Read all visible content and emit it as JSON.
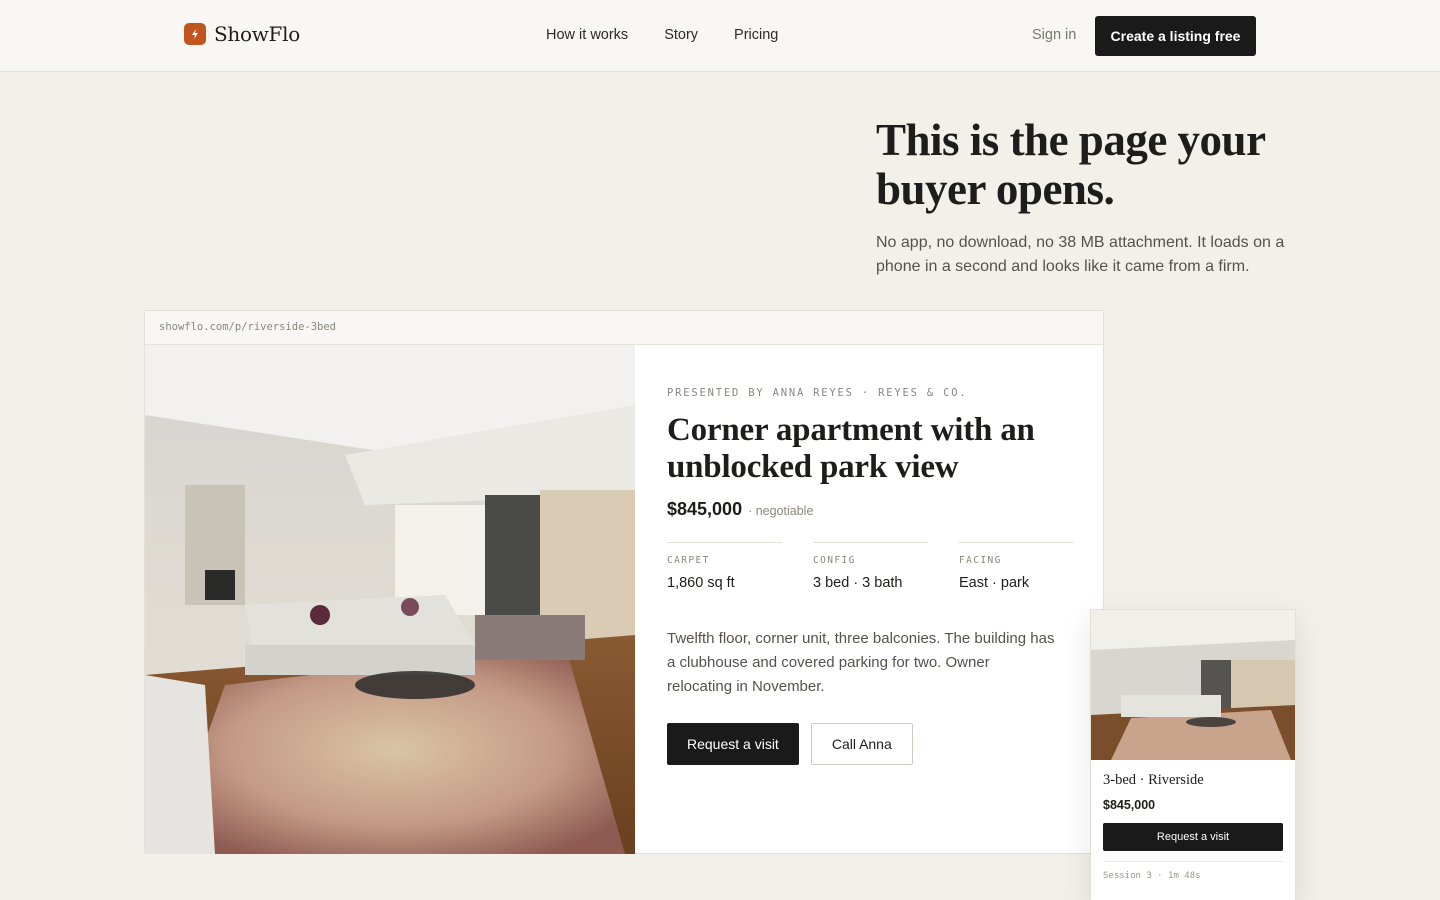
{
  "nav": {
    "brand": "ShowFlo",
    "links": [
      "How it works",
      "Story",
      "Pricing"
    ],
    "sign_in": "Sign in",
    "cta": "Create a listing free"
  },
  "hero": {
    "title": "This is the page your buyer opens.",
    "subtitle": "No app, no download, no 38 MB attachment. It loads on a phone in a second and looks like it came from a firm."
  },
  "listing": {
    "url": "showflo.com/p/riverside-3bed",
    "presented_by": "PRESENTED BY ANNA REYES · REYES & CO.",
    "title": "Corner apartment with an unblocked park view",
    "price": "$845,000",
    "price_note": "· negotiable",
    "specs": [
      {
        "label": "CARPET",
        "value": "1,860 sq ft"
      },
      {
        "label": "CONFIG",
        "value": "3 bed · 3 bath"
      },
      {
        "label": "FACING",
        "value": "East · park"
      }
    ],
    "description": "Twelfth floor, corner unit, three balconies. The building has a clubhouse and covered parking for two. Owner relocating in November.",
    "primary_action": "Request a visit",
    "secondary_action": "Call Anna"
  },
  "phone_preview": {
    "title": "3-bed · Riverside",
    "price": "$845,000",
    "action": "Request a visit",
    "session": "Session 3 · 1m 48s"
  },
  "colors": {
    "page_bg": "#f3f0e9",
    "nav_bg": "#f8f7f3",
    "brand_accent": "#c2551e",
    "button_dark": "#1a1a1a",
    "muted_text": "#8a877e"
  },
  "icons": {
    "brand": "bolt-icon"
  }
}
